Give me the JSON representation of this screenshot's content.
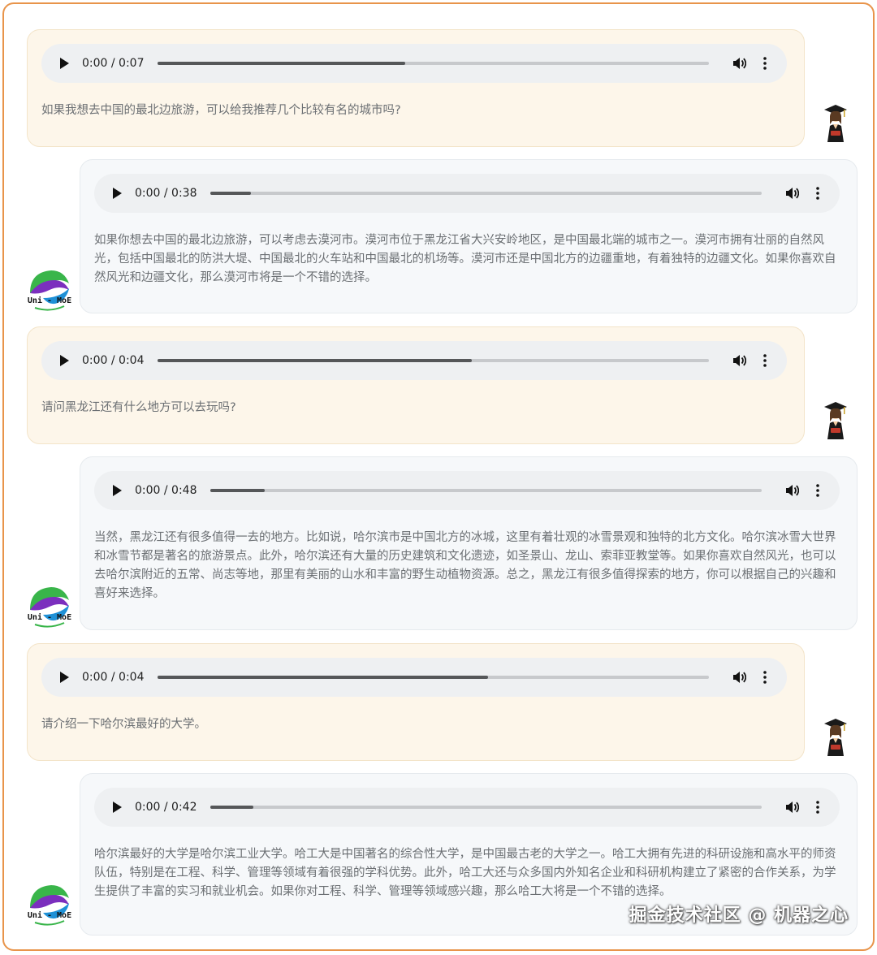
{
  "messages": [
    {
      "role": "user",
      "audio_time": "0:00 / 0:07",
      "progress": 0.45,
      "text": "如果我想去中国的最北边旅游，可以给我推荐几个比较有名的城市吗?"
    },
    {
      "role": "bot",
      "audio_time": "0:00 / 0:38",
      "progress": 0.075,
      "text": "如果你想去中国的最北边旅游，可以考虑去漠河市。漠河市位于黑龙江省大兴安岭地区，是中国最北端的城市之一。漠河市拥有壮丽的自然风光，包括中国最北的防洪大堤、中国最北的火车站和中国最北的机场等。漠河市还是中国北方的边疆重地，有着独特的边疆文化。如果你喜欢自然风光和边疆文化，那么漠河市将是一个不错的选择。"
    },
    {
      "role": "user",
      "audio_time": "0:00 / 0:04",
      "progress": 0.57,
      "text": "请问黑龙江还有什么地方可以去玩吗?"
    },
    {
      "role": "bot",
      "audio_time": "0:00 / 0:48",
      "progress": 0.1,
      "text": "当然，黑龙江还有很多值得一去的地方。比如说，哈尔滨市是中国北方的冰城，这里有着壮观的冰雪景观和独特的北方文化。哈尔滨冰雪大世界和冰雪节都是著名的旅游景点。此外，哈尔滨还有大量的历史建筑和文化遗迹，如圣景山、龙山、索菲亚教堂等。如果你喜欢自然风光，也可以去哈尔滨附近的五常、尚志等地，那里有美丽的山水和丰富的野生动植物资源。总之，黑龙江有很多值得探索的地方，你可以根据自己的兴趣和喜好来选择。"
    },
    {
      "role": "user",
      "audio_time": "0:00 / 0:04",
      "progress": 0.6,
      "text": "请介绍一下哈尔滨最好的大学。"
    },
    {
      "role": "bot",
      "audio_time": "0:00 / 0:42",
      "progress": 0.078,
      "text": "哈尔滨最好的大学是哈尔滨工业大学。哈工大是中国著名的综合性大学，是中国最古老的大学之一。哈工大拥有先进的科研设施和高水平的师资队伍，特别是在工程、科学、管理等领域有着很强的学科优势。此外，哈工大还与众多国内外知名企业和科研机构建立了紧密的合作关系，为学生提供了丰富的实习和就业机会。如果你对工程、科学、管理等领域感兴趣，那么哈工大将是一个不错的选择。"
    }
  ],
  "bot_logo_text": "Uni - MoE",
  "watermark": "掘金技术社区 @ 机器之心",
  "colors": {
    "frame": "#e8944a",
    "user_bg": "#fdf6ea",
    "bot_bg": "#f6f8fa",
    "logo_green": "#39b54a",
    "logo_purple": "#7b2fbe",
    "logo_blue": "#1e90d6"
  }
}
